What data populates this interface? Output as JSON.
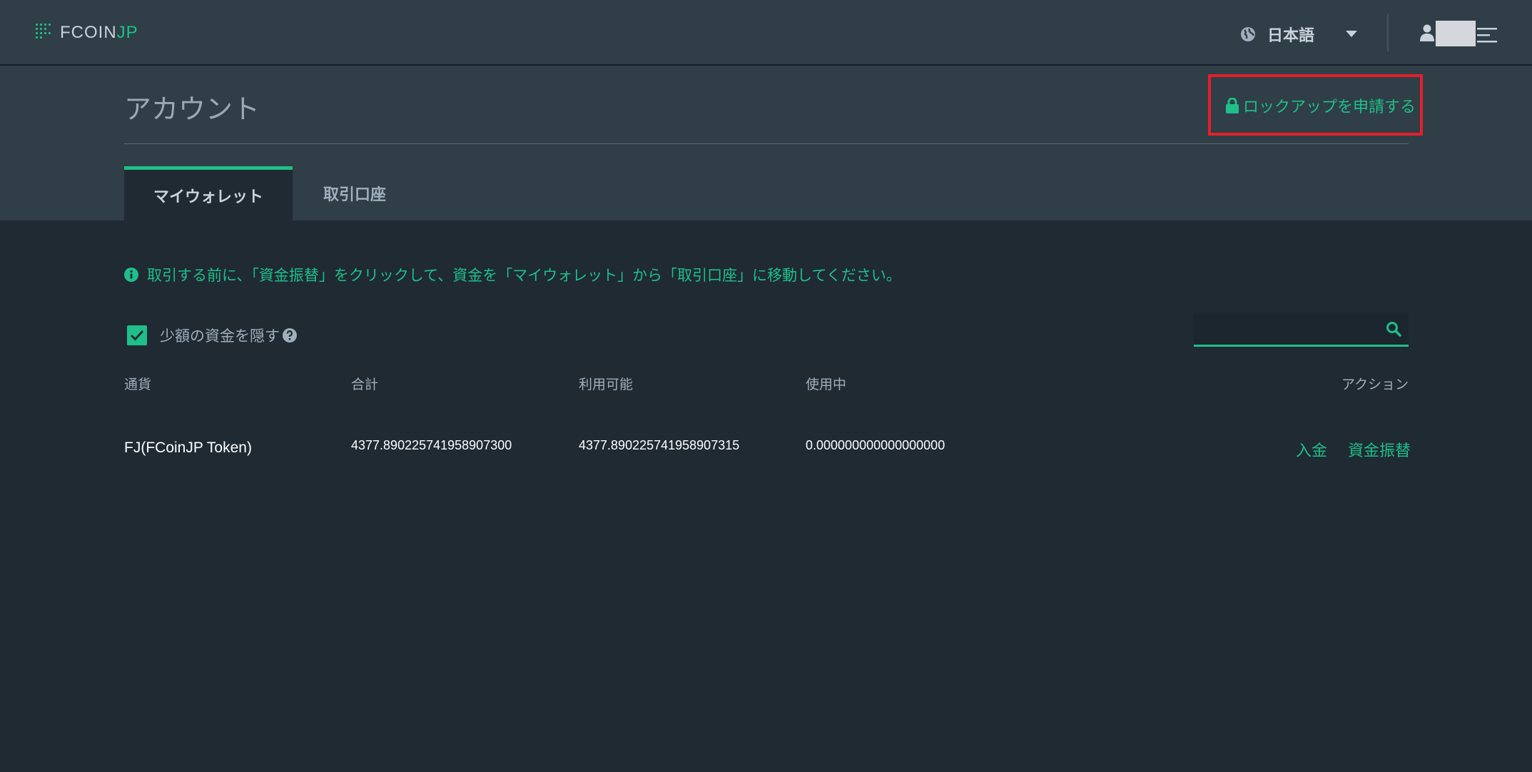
{
  "navbar": {
    "logo_main": "FCOIN",
    "logo_accent": "JP",
    "language_label": "日本語"
  },
  "header": {
    "title": "アカウント",
    "lockup_label": "ロックアップを申請する",
    "tabs": [
      {
        "label": "マイウォレット",
        "active": true
      },
      {
        "label": "取引口座",
        "active": false
      }
    ]
  },
  "main": {
    "notice": "取引する前に、「資金振替」をクリックして、資金を「マイウォレット」から「取引口座」に移動してください。",
    "hide_small_label": "少額の資金を隠す",
    "hide_small_checked": true,
    "search": {
      "value": "",
      "placeholder": ""
    },
    "table": {
      "headers": [
        "通貨",
        "合計",
        "利用可能",
        "使用中",
        "アクション"
      ],
      "rows": [
        {
          "currency": "FJ(FCoinJP Token)",
          "total": "4377.890225741958907300",
          "available": "4377.890225741958907315",
          "in_use": "0.000000000000000000",
          "actions": [
            "入金",
            "資金振替"
          ]
        }
      ]
    }
  },
  "colors": {
    "accent": "#1fbf8a",
    "background": "#1f2a33",
    "header_band": "#2f3e47",
    "highlight": "#e3202b"
  },
  "icons": [
    "logo-dots-icon",
    "globe-icon",
    "caret-down-icon",
    "user-icon",
    "menu-icon",
    "lock-icon",
    "info-icon",
    "check-icon",
    "help-icon",
    "search-icon"
  ]
}
